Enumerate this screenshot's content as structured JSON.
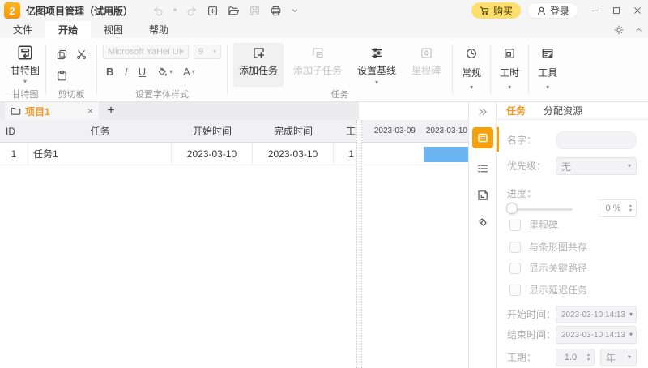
{
  "icons": {
    "dropdown": "▾",
    "spin_up": "▴",
    "spin_down": "▾",
    "logo": "2"
  },
  "titlebar": {
    "title": "亿图项目管理（试用版）",
    "buy": "购买",
    "login": "登录"
  },
  "menu": {
    "items": [
      "文件",
      "开始",
      "视图",
      "帮助"
    ]
  },
  "ribbon": {
    "gantt_button": "甘特图",
    "gantt_group": "甘特图",
    "clipboard_group": "剪切板",
    "font_family": "Microsoft YaHei UI",
    "font_size": "9",
    "bold": "B",
    "italic": "I",
    "underline": "U",
    "font_color": "A",
    "font_group": "设置字体样式",
    "add_task": "添加任务",
    "add_subtask": "添加子任务",
    "set_baseline": "设置基线",
    "milestone": "里程碑",
    "task_group": "任务",
    "general": "常规",
    "worktime": "工时",
    "tools": "工具"
  },
  "tabstrip": {
    "tab": "项目1",
    "close": "×",
    "add": "+"
  },
  "table": {
    "headers": [
      "ID",
      "任务",
      "开始时间",
      "完成时间",
      "工"
    ],
    "row": {
      "id": "1",
      "task": "任务1",
      "start": "2023-03-10",
      "finish": "2023-03-10",
      "duration": "1"
    }
  },
  "gantt": {
    "dates": [
      "2023-03-09",
      "2023-03-10"
    ]
  },
  "sidebar": {
    "tab_task": "任务",
    "tab_resource": "分配资源",
    "name_label": "名字：",
    "priority_label": "优先级：",
    "priority_value": "无",
    "progress_label": "进度：",
    "progress_value": "0 %",
    "checkboxes": [
      "里程碑",
      "与条形图共存",
      "显示关键路径",
      "显示延迟任务"
    ],
    "start_label": "开始时间：",
    "start_value": "2023-03-10 14:13",
    "end_label": "结束时间：",
    "end_value": "2023-03-10 14:13",
    "duration_label": "工期：",
    "duration_value": "1.0",
    "duration_unit": "年"
  },
  "colors": {
    "accent": "#F7A10A",
    "tab_text": "#F59A23",
    "bar_blue": "#6DB4F3",
    "buy_yellow": "#FFDF6B"
  }
}
